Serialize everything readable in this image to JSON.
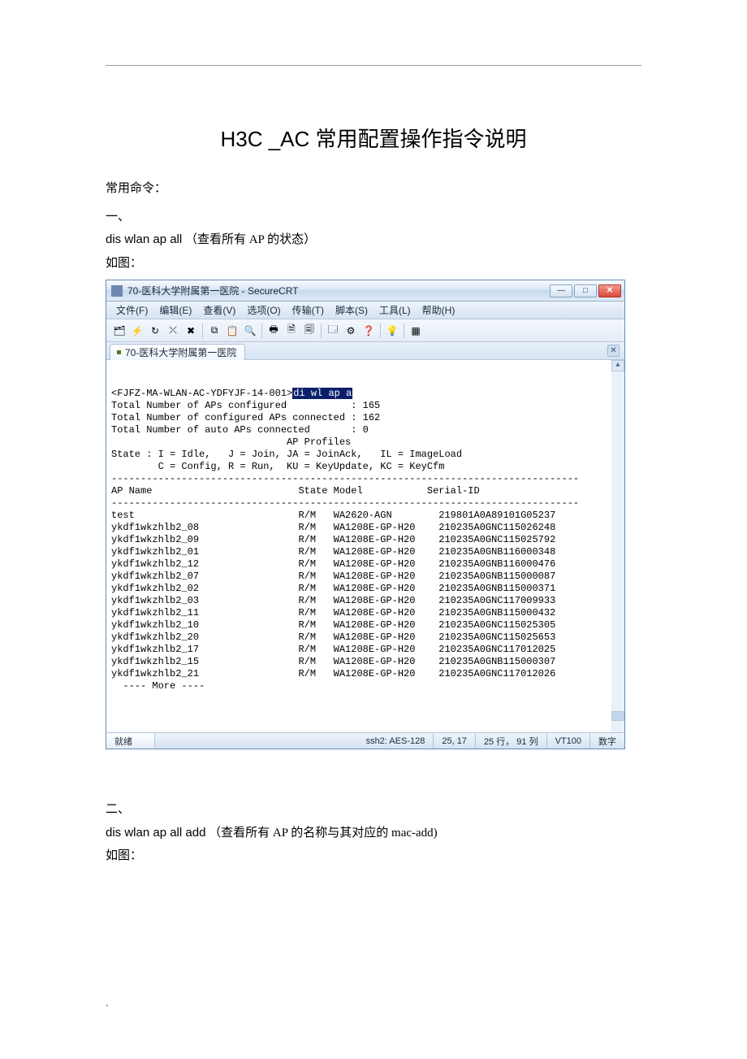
{
  "doc": {
    "title": "H3C _AC 常用配置操作指令说明",
    "heading_common": "常用命令：",
    "sec1_num": "一、",
    "sec1_cmd": "dis wlan ap all",
    "sec1_note": "（查看所有   AP 的状态）",
    "sec1_fig": "如图：",
    "sec2_num": "二、",
    "sec2_cmd": "dis wlan ap all add",
    "sec2_note": "（查看所有   AP 的名称与其对应的     mac-add)",
    "sec2_fig": "如图：",
    "footer_dot": "."
  },
  "crt": {
    "title": "70-医科大学附属第一医院 - SecureCRT",
    "menus": [
      "文件(F)",
      "编辑(E)",
      "查看(V)",
      "选项(O)",
      "传输(T)",
      "脚本(S)",
      "工具(L)",
      "帮助(H)"
    ],
    "toolbar_icons": [
      "session-manager-icon",
      "quick-connect-icon",
      "reconnect-icon",
      "disconnect-icon",
      "close-icon",
      "sep",
      "copy-icon",
      "paste-icon",
      "find-icon",
      "sep",
      "print-icon",
      "print-setup-icon",
      "print-preview-icon",
      "sep",
      "properties-icon",
      "options-icon",
      "trace-icon",
      "sep",
      "help-icon",
      "sep",
      "tile-icon"
    ],
    "tab_label": "70-医科大学附属第一医院",
    "term_prompt_prefix": "<FJFZ-MA-WLAN-AC-YDFYJF-14-001>",
    "term_cmd_hl": "di wl ap a",
    "term_header": [
      "Total Number of APs configured           : 165",
      "Total Number of configured APs connected : 162",
      "Total Number of auto APs connected       : 0",
      "                              AP Profiles",
      "State : I = Idle,   J = Join, JA = JoinAck,   IL = ImageLoad",
      "        C = Config, R = Run,  KU = KeyUpdate, KC = KeyCfm",
      "--------------------------------------------------------------------------------",
      "AP Name                         State Model           Serial-ID",
      "--------------------------------------------------------------------------------"
    ],
    "term_rows": [
      {
        "name": "test",
        "state": "R/M",
        "model": "WA2620-AGN",
        "serial": "219801A0A89101G05237"
      },
      {
        "name": "ykdf1wkzhlb2_08",
        "state": "R/M",
        "model": "WA1208E-GP-H20",
        "serial": "210235A0GNC115026248"
      },
      {
        "name": "ykdf1wkzhlb2_09",
        "state": "R/M",
        "model": "WA1208E-GP-H20",
        "serial": "210235A0GNC115025792"
      },
      {
        "name": "ykdf1wkzhlb2_01",
        "state": "R/M",
        "model": "WA1208E-GP-H20",
        "serial": "210235A0GNB116000348"
      },
      {
        "name": "ykdf1wkzhlb2_12",
        "state": "R/M",
        "model": "WA1208E-GP-H20",
        "serial": "210235A0GNB116000476"
      },
      {
        "name": "ykdf1wkzhlb2_07",
        "state": "R/M",
        "model": "WA1208E-GP-H20",
        "serial": "210235A0GNB115000087"
      },
      {
        "name": "ykdf1wkzhlb2_02",
        "state": "R/M",
        "model": "WA1208E-GP-H20",
        "serial": "210235A0GNB115000371"
      },
      {
        "name": "ykdf1wkzhlb2_03",
        "state": "R/M",
        "model": "WA1208E-GP-H20",
        "serial": "210235A0GNC117009933"
      },
      {
        "name": "ykdf1wkzhlb2_11",
        "state": "R/M",
        "model": "WA1208E-GP-H20",
        "serial": "210235A0GNB115000432"
      },
      {
        "name": "ykdf1wkzhlb2_10",
        "state": "R/M",
        "model": "WA1208E-GP-H20",
        "serial": "210235A0GNC115025305"
      },
      {
        "name": "ykdf1wkzhlb2_20",
        "state": "R/M",
        "model": "WA1208E-GP-H20",
        "serial": "210235A0GNC115025653"
      },
      {
        "name": "ykdf1wkzhlb2_17",
        "state": "R/M",
        "model": "WA1208E-GP-H20",
        "serial": "210235A0GNC117012025"
      },
      {
        "name": "ykdf1wkzhlb2_15",
        "state": "R/M",
        "model": "WA1208E-GP-H20",
        "serial": "210235A0GNB115000307"
      },
      {
        "name": "ykdf1wkzhlb2_21",
        "state": "R/M",
        "model": "WA1208E-GP-H20",
        "serial": "210235A0GNC117012026"
      }
    ],
    "term_more": "  ---- More ----",
    "status": {
      "ready": "就绪",
      "enc": "ssh2: AES-128",
      "pos": "25,  17",
      "size": "25 行， 91 列",
      "term": "VT100",
      "numlock": "数字"
    }
  }
}
